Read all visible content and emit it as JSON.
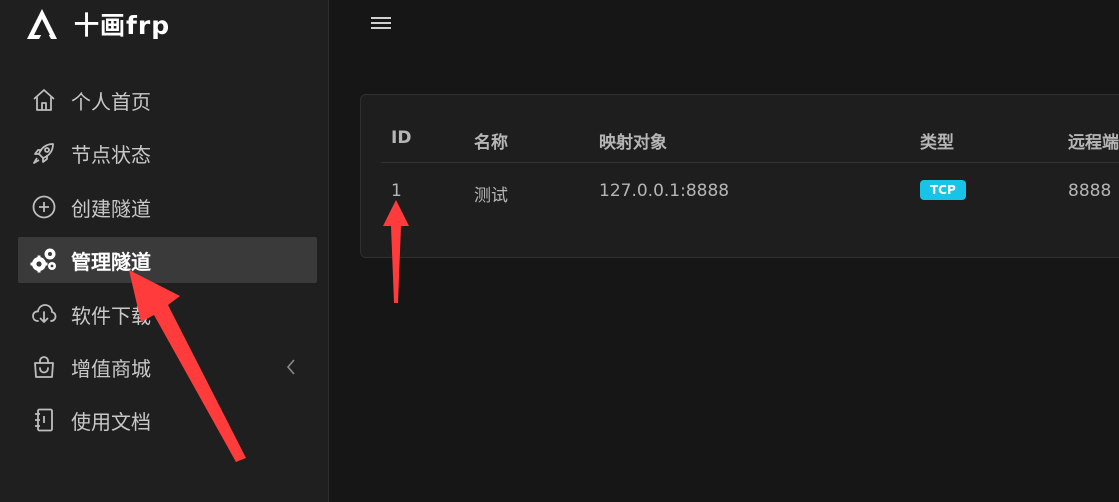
{
  "brand": {
    "name": "十画frp",
    "logo_icon": "triangle-logo-icon"
  },
  "sidebar": {
    "items": [
      {
        "label": "个人首页",
        "icon": "home-icon",
        "active": false
      },
      {
        "label": "节点状态",
        "icon": "rocket-icon",
        "active": false
      },
      {
        "label": "创建隧道",
        "icon": "plus-circle-icon",
        "active": false
      },
      {
        "label": "管理隧道",
        "icon": "gears-icon",
        "active": true
      },
      {
        "label": "软件下载",
        "icon": "cloud-download-icon",
        "active": false
      },
      {
        "label": "增值商城",
        "icon": "shopping-bag-icon",
        "active": false,
        "expandable": true
      },
      {
        "label": "使用文档",
        "icon": "notebook-icon",
        "active": false
      }
    ]
  },
  "table": {
    "headers": [
      "ID",
      "名称",
      "映射对象",
      "类型",
      "远程端"
    ],
    "rows": [
      {
        "id": "1",
        "name": "测试",
        "target": "127.0.0.1:8888",
        "type": "TCP",
        "remote": "8888"
      }
    ]
  },
  "colors": {
    "sidebar_bg": "#1f1f1f",
    "active_bg": "#3a3a3a",
    "badge": "#18c3e8",
    "arrow": "#ff3b3b"
  }
}
